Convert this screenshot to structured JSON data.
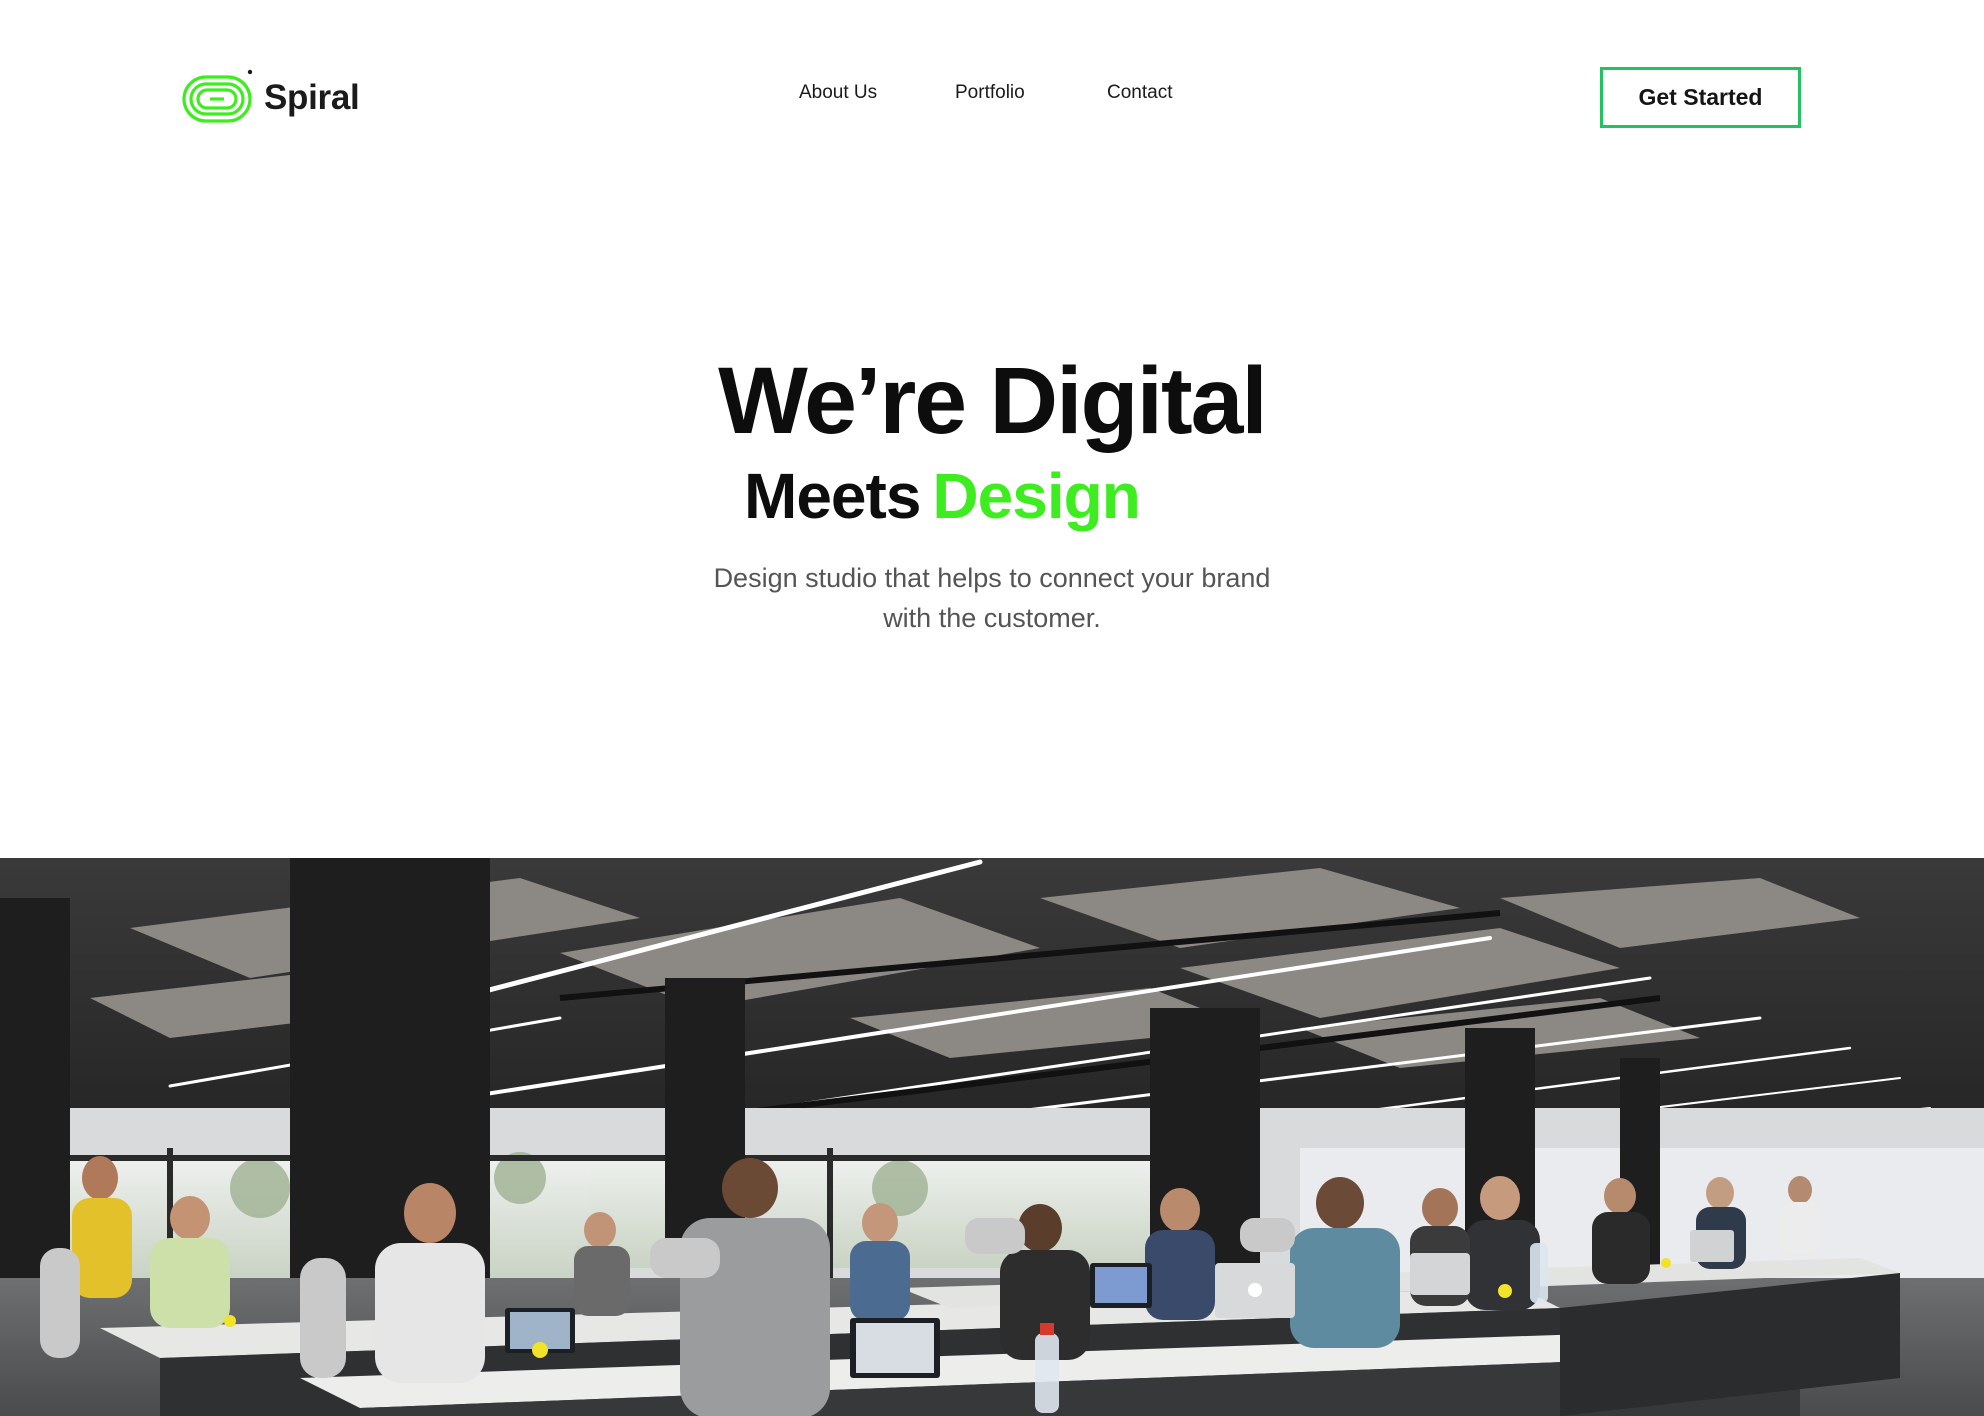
{
  "brand": {
    "name": "Spiral",
    "logo_icon": "spiral-logo-icon",
    "accent_color": "#3ded1f",
    "logo_color": "#3ded1f"
  },
  "nav": {
    "items": [
      {
        "label": "About Us"
      },
      {
        "label": "Portfolio"
      },
      {
        "label": "Contact"
      }
    ]
  },
  "header": {
    "cta_label": "Get Started",
    "cta_border_color": "#22c35e"
  },
  "hero": {
    "title_line1": "We’re Digital",
    "title_line2_word1": "Meets",
    "title_line2_word2": "Design",
    "subtitle_line1": "Design studio that helps to connect your brand",
    "subtitle_line2": "with the customer."
  },
  "photo": {
    "subject": "open-plan office with people working at laptops on long desks"
  }
}
